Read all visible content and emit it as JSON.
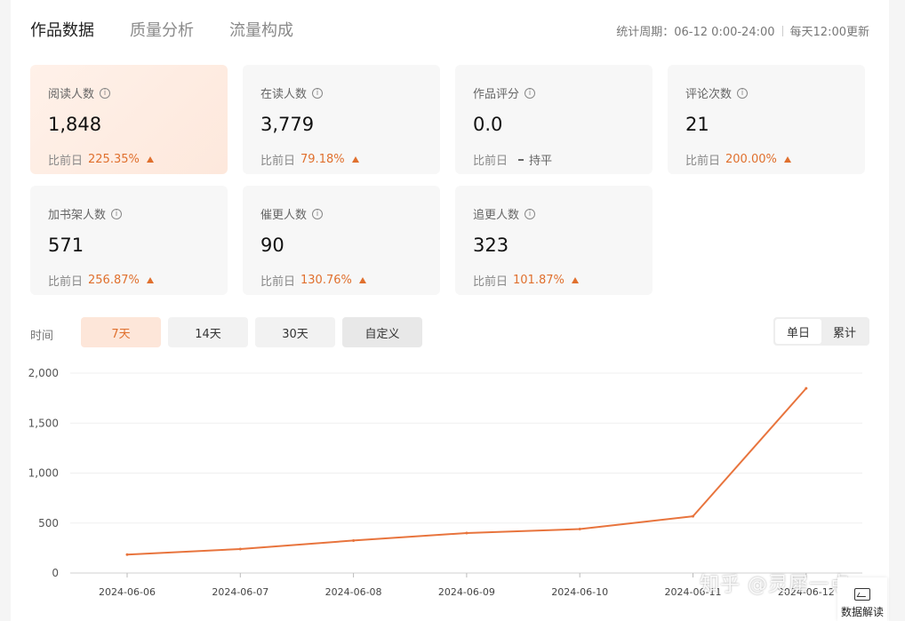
{
  "tabs": [
    {
      "label": "作品数据",
      "active": true
    },
    {
      "label": "质量分析",
      "active": false
    },
    {
      "label": "流量构成",
      "active": false
    }
  ],
  "period": {
    "text": "统计周期：06-12 0:00-24:00",
    "update": "每天12:00更新"
  },
  "metrics": [
    {
      "label": "阅读人数",
      "value": "1,848",
      "compare_label": "比前日",
      "change": "225.35%",
      "trend": "up"
    },
    {
      "label": "在读人数",
      "value": "3,779",
      "compare_label": "比前日",
      "change": "79.18%",
      "trend": "up"
    },
    {
      "label": "作品评分",
      "value": "0.0",
      "compare_label": "比前日",
      "change": "持平",
      "trend": "flat"
    },
    {
      "label": "评论次数",
      "value": "21",
      "compare_label": "比前日",
      "change": "200.00%",
      "trend": "up"
    },
    {
      "label": "加书架人数",
      "value": "571",
      "compare_label": "比前日",
      "change": "256.87%",
      "trend": "up"
    },
    {
      "label": "催更人数",
      "value": "90",
      "compare_label": "比前日",
      "change": "130.76%",
      "trend": "up"
    },
    {
      "label": "追更人数",
      "value": "323",
      "compare_label": "比前日",
      "change": "101.87%",
      "trend": "up"
    }
  ],
  "info_glyph": "i",
  "time_filter": {
    "label": "时间",
    "options": [
      "7天",
      "14天",
      "30天",
      "自定义"
    ],
    "active": "7天"
  },
  "view_toggle": {
    "options": [
      "单日",
      "累计"
    ],
    "active": "单日"
  },
  "chart_data": {
    "type": "line",
    "x": [
      "2024-06-06",
      "2024-06-07",
      "2024-06-08",
      "2024-06-09",
      "2024-06-10",
      "2024-06-11",
      "2024-06-12"
    ],
    "x_tick_labels": [
      "2024-06-06",
      "2024-06-07",
      "2024-06-08",
      "2024-06-09",
      "2024-06-10",
      "2024-06-11",
      "2024-06-12"
    ],
    "series": [
      {
        "values": [
          185,
          240,
          325,
          400,
          440,
          568,
          1848
        ]
      }
    ],
    "y_ticks": [
      "0",
      "500",
      "1,000",
      "1,500",
      "2,000"
    ],
    "ylim": [
      0,
      2000
    ],
    "grid": true,
    "color": "#e8743d"
  },
  "watermark": "知乎 @灵犀一点",
  "interpret_button": {
    "label": "数据解读",
    "icon": "chart-icon"
  },
  "colors": {
    "accent": "#e0702e",
    "active_card_bg": "#fde8dc"
  }
}
